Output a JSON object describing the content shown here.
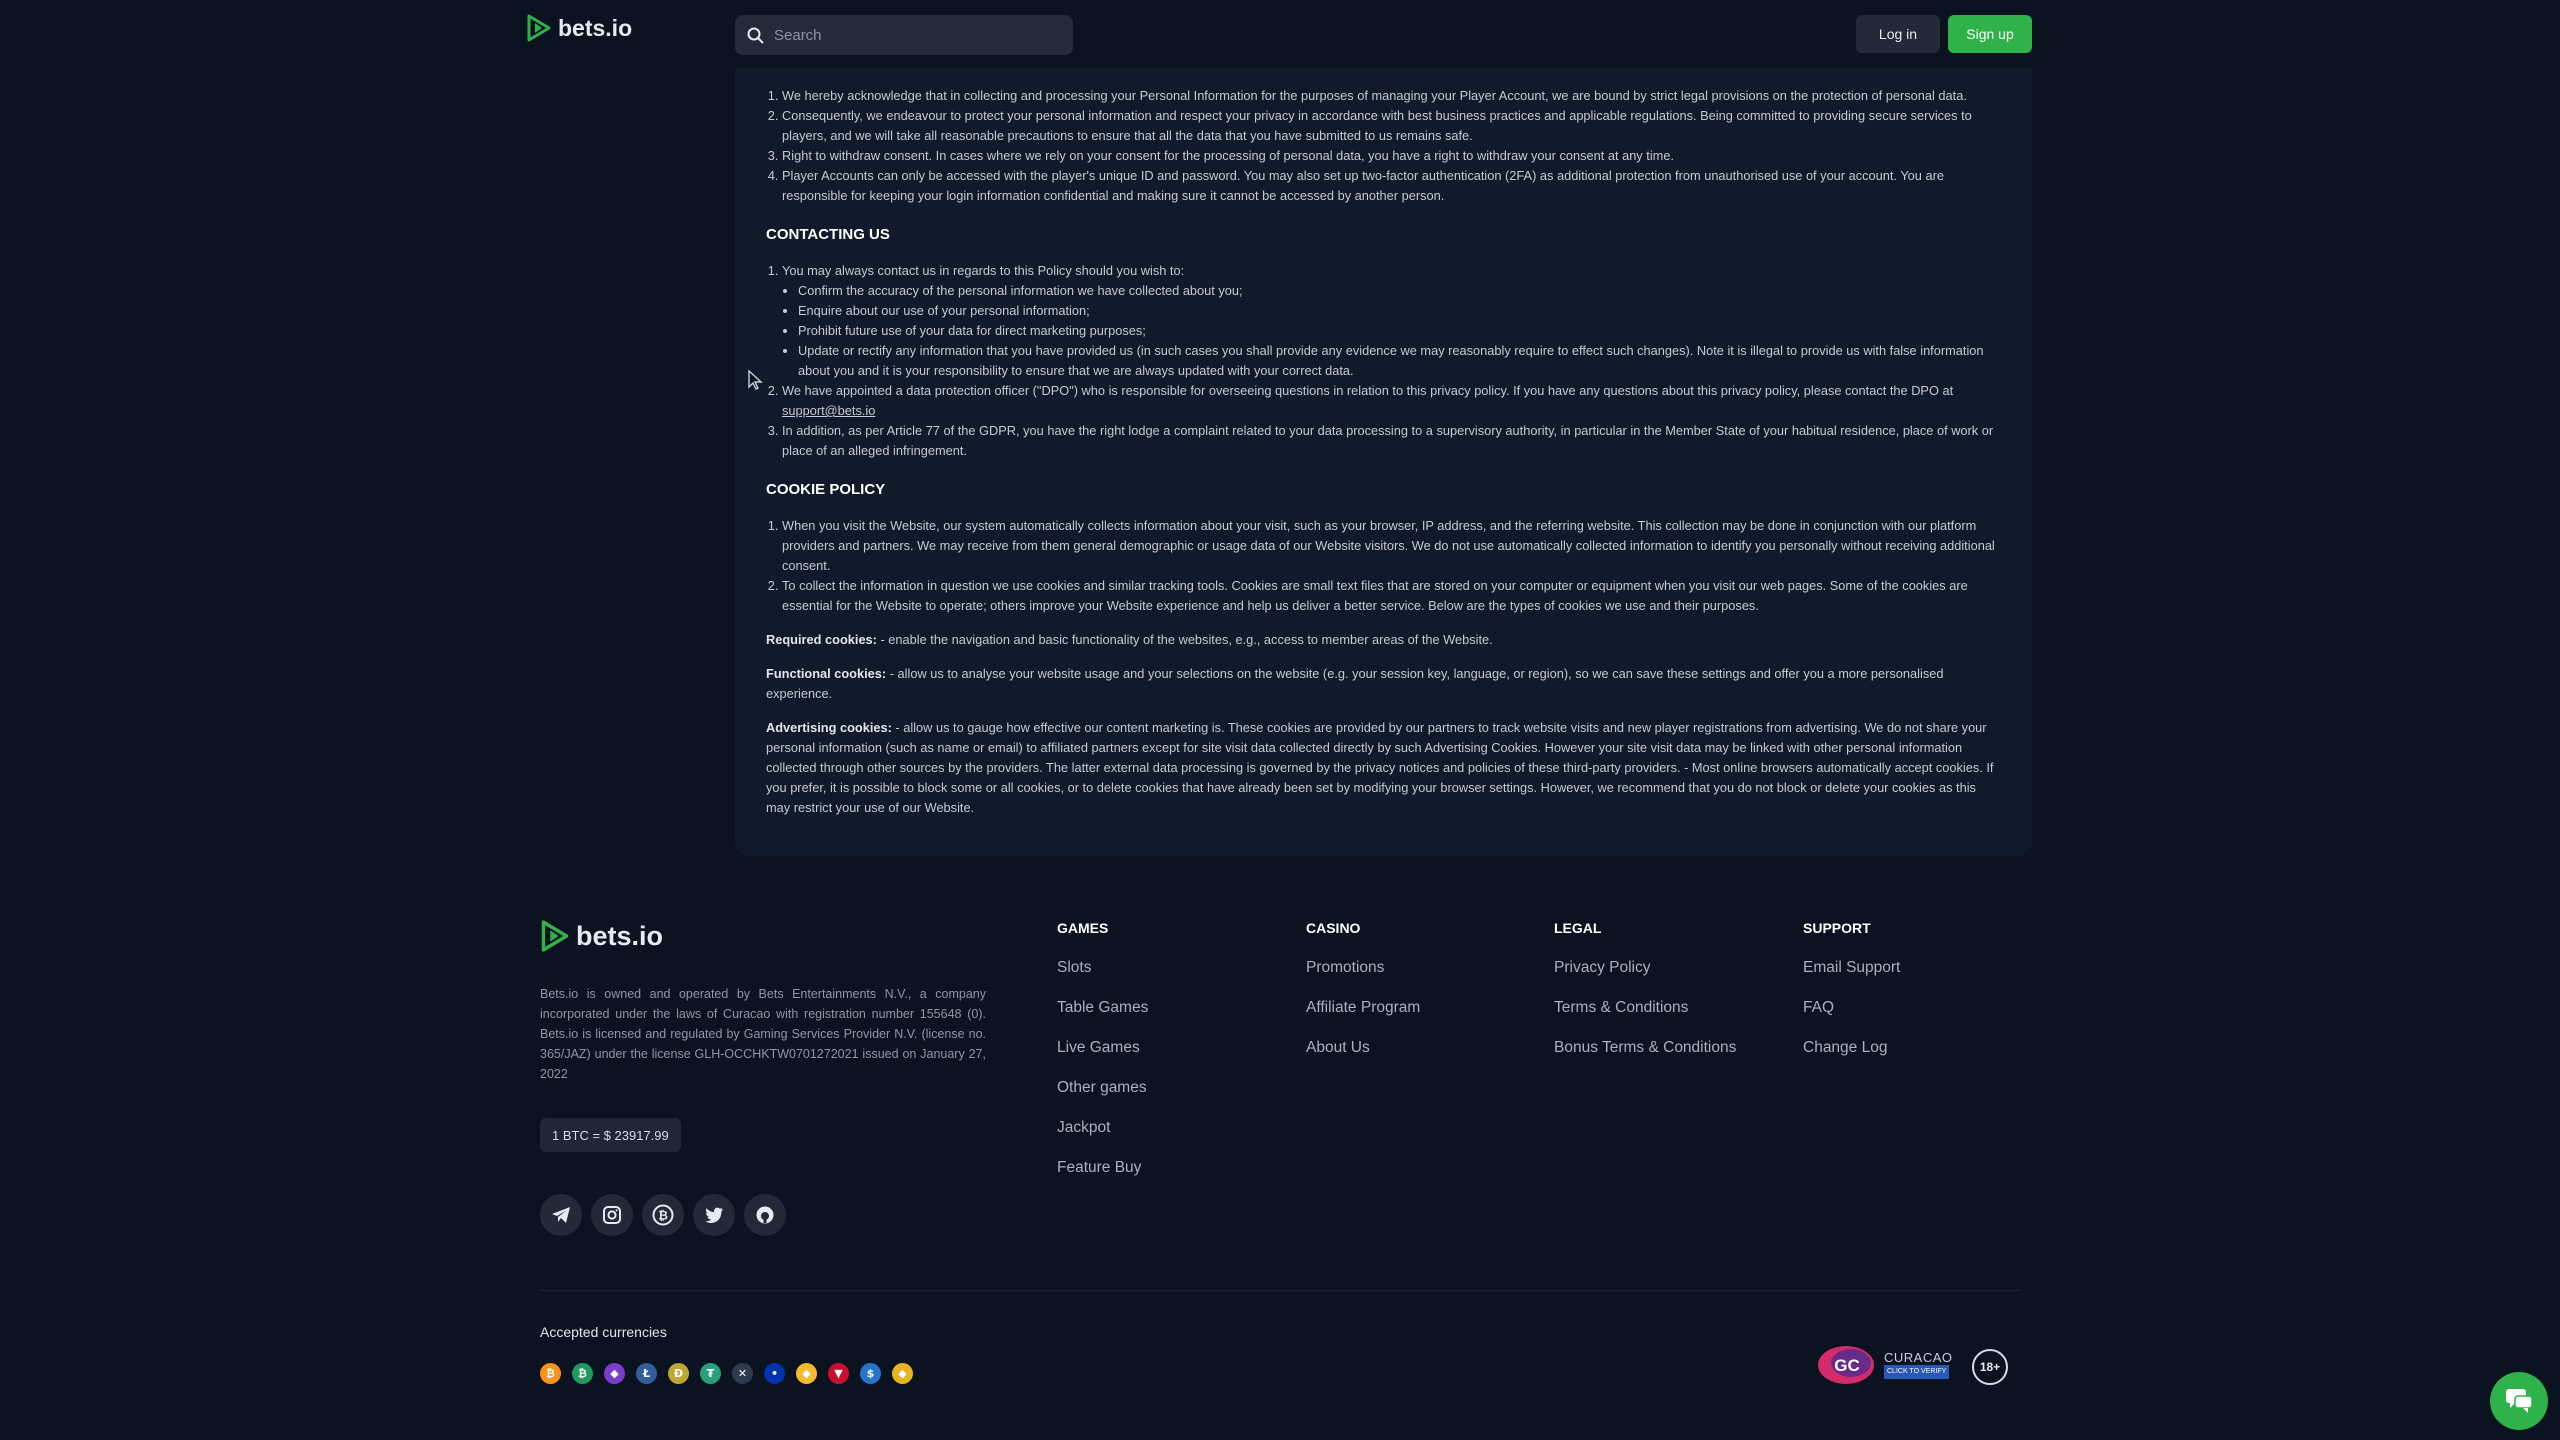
{
  "header": {
    "brand": "bets.io",
    "search_placeholder": "Search",
    "login_label": "Log in",
    "signup_label": "Sign up"
  },
  "policy": {
    "intro_items": [
      "We hereby acknowledge that in collecting and processing your Personal Information for the purposes of managing your Player Account, we are bound by strict legal provisions on the protection of personal data.",
      "Consequently, we endeavour to protect your personal information and respect your privacy in accordance with best business practices and applicable regulations. Being committed to providing secure services to players, and we will take all reasonable precautions to ensure that all the data that you have submitted to us remains safe.",
      "Right to withdraw consent. In cases where we rely on your consent for the processing of personal data, you have a right to withdraw your consent at any time.",
      "Player Accounts can only be accessed with the player's unique ID and password. You may also set up two-factor authentication (2FA) as additional protection from unauthorised use of your account. You are responsible for keeping your login information confidential and making sure it cannot be accessed by another person."
    ],
    "contact_heading": "CONTACTING US",
    "contact_item1": "You may always contact us in regards to this Policy should you wish to:",
    "contact_subitems": [
      "Confirm the accuracy of the personal information we have collected about you;",
      "Enquire about our use of your personal information;",
      "Prohibit future use of your data for direct marketing purposes;",
      "Update or rectify any information that you have provided us (in such cases you shall provide any evidence we may reasonably require to effect such changes). Note it is illegal to provide us with false information about you and it is your responsibility to ensure that we are always updated with your correct data."
    ],
    "contact_item2": "We have appointed a data protection officer (\"DPO\") who is responsible for overseeing questions in relation to this privacy policy. If you have any questions about this privacy policy, please contact the DPO at ",
    "contact_email": "support@bets.io",
    "contact_item3": "In addition, as per Article 77 of the GDPR, you have the right lodge a complaint related to your data processing to a supervisory authority, in particular in the Member State of your habitual residence, place of work or place of an alleged infringement.",
    "cookie_heading": "COOKIE POLICY",
    "cookie_items": [
      "When you visit the Website, our system automatically collects information about your visit, such as your browser, IP address, and the referring website. This collection may be done in conjunction with our platform providers and partners. We may receive from them general demographic or usage data of our Website visitors. We do not use automatically collected information to identify you personally without receiving additional consent.",
      "To collect the information in question we use cookies and similar tracking tools. Cookies are small text files that are stored on your computer or equipment when you visit our web pages. Some of the cookies are essential for the Website to operate; others improve your Website experience and help us deliver a better service. Below are the types of cookies we use and their purposes."
    ],
    "required_label": "Required cookies:",
    "required_text": " - enable the navigation and basic functionality of the websites, e.g., access to member areas of the Website.",
    "functional_label": "Functional cookies:",
    "functional_text": " - allow us to analyse your website usage and your selections on the website (e.g. your session key, language, or region), so we can save these settings and offer you a more personalised experience.",
    "advertising_label": "Advertising cookies:",
    "advertising_text": " - allow us to gauge how effective our content marketing is. These cookies are provided by our partners to track website visits and new player registrations from advertising. We do not share your personal information (such as name or email) to affiliated partners except for site visit data collected directly by such Advertising Cookies. However your site visit data may be linked with other personal information collected through other sources by the providers. The latter external data processing is governed by the privacy notices and policies of these third-party providers. - Most online browsers automatically accept cookies. If you prefer, it is possible to block some or all cookies, or to delete cookies that have already been set by modifying your browser settings. However, we recommend that you do not block or delete your cookies as this may restrict your use of our Website."
  },
  "footer": {
    "brand": "bets.io",
    "description": "Bets.io is owned and operated by Bets Entertainments N.V., a company incorporated under the laws of Curacao with registration number 155648 (0). Bets.io is licensed and regulated by Gaming Services Provider N.V. (license no. 365/JAZ) under the license GLH-OCCHKTW0701272021 issued on January 27, 2022",
    "btc_rate": "1 BTC = $ 23917.99",
    "columns": [
      {
        "title": "GAMES",
        "links": [
          "Slots",
          "Table Games",
          "Live Games",
          "Other games",
          "Jackpot",
          "Feature Buy"
        ]
      },
      {
        "title": "CASINO",
        "links": [
          "Promotions",
          "Affiliate Program",
          "About Us"
        ]
      },
      {
        "title": "LEGAL",
        "links": [
          "Privacy Policy",
          "Terms & Conditions",
          "Bonus Terms & Conditions"
        ]
      },
      {
        "title": "SUPPORT",
        "links": [
          "Email Support",
          "FAQ",
          "Change Log"
        ]
      }
    ],
    "accepted_currencies": "Accepted currencies",
    "currency_icons": [
      {
        "name": "bitcoin-icon",
        "glyph": "₿",
        "color": "#f7931a"
      },
      {
        "name": "bitcoin-cash-icon",
        "glyph": "₿",
        "color": "#1f9a5c"
      },
      {
        "name": "ethereum-icon",
        "glyph": "◆",
        "color": "#7d3cc9"
      },
      {
        "name": "litecoin-icon",
        "glyph": "Ł",
        "color": "#345d9d"
      },
      {
        "name": "dogecoin-icon",
        "glyph": "Ð",
        "color": "#c2a633"
      },
      {
        "name": "tether-icon",
        "glyph": "₮",
        "color": "#26a17b"
      },
      {
        "name": "ripple-icon",
        "glyph": "✕",
        "color": "#2e3a4f"
      },
      {
        "name": "cardano-icon",
        "glyph": "•",
        "color": "#0033ad"
      },
      {
        "name": "bnb-icon",
        "glyph": "◆",
        "color": "#f3ba2f"
      },
      {
        "name": "tron-icon",
        "glyph": "▼",
        "color": "#c8102e"
      },
      {
        "name": "usdc-icon",
        "glyph": "$",
        "color": "#2775ca"
      },
      {
        "name": "bnb-gold-icon",
        "glyph": "◆",
        "color": "#e6b422"
      }
    ],
    "license_text": "CURACAO",
    "license_sub": "CLICK TO VERIFY",
    "license_badge": "GC",
    "age_badge": "18+"
  },
  "colors": {
    "background": "#0b1220",
    "panel": "#111a2a",
    "accent_green": "#2fb24a"
  }
}
